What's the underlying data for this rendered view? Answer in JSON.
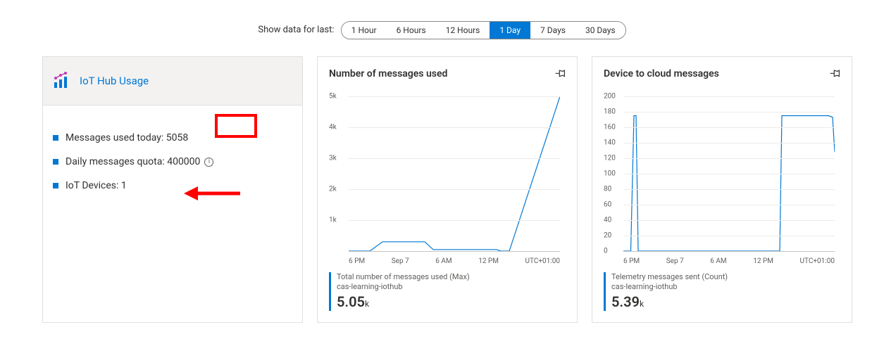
{
  "time_range": {
    "label": "Show data for last:",
    "options": [
      "1 Hour",
      "6 Hours",
      "12 Hours",
      "1 Day",
      "7 Days",
      "30 Days"
    ],
    "active_index": 3
  },
  "usage_card": {
    "title": "IoT Hub Usage",
    "rows": {
      "messages_used_label": "Messages used today:",
      "messages_used_value": "5058",
      "daily_quota_label": "Daily messages quota:",
      "daily_quota_value": "400000",
      "devices_label": "IoT Devices:",
      "devices_value": "1"
    }
  },
  "chart1": {
    "title": "Number of messages used",
    "metric_label": "Total number of messages used (Max)",
    "resource": "cas-learning-iothub",
    "value": "5.05",
    "unit": "k",
    "tz": "UTC+01:00"
  },
  "chart2": {
    "title": "Device to cloud messages",
    "metric_label": "Telemetry messages sent (Count)",
    "resource": "cas-learning-iothub",
    "value": "5.39",
    "unit": "k",
    "tz": "UTC+01:00"
  },
  "chart_data": [
    {
      "type": "line",
      "title": "Number of messages used",
      "xlabel": "",
      "ylabel": "",
      "ylim": [
        0,
        5000
      ],
      "x_ticks": [
        "6 PM",
        "Sep 7",
        "6 AM",
        "12 PM"
      ],
      "y_ticks": [
        1000,
        2000,
        3000,
        4000,
        5000
      ],
      "series": [
        {
          "name": "Total number of messages used (Max)",
          "x": [
            0.0,
            0.1,
            0.16,
            0.2,
            0.36,
            0.4,
            0.7,
            0.72,
            0.76,
            1.0
          ],
          "y": [
            0,
            0,
            300,
            300,
            300,
            50,
            50,
            0,
            0,
            5000
          ]
        }
      ]
    },
    {
      "type": "line",
      "title": "Device to cloud messages",
      "xlabel": "",
      "ylabel": "",
      "ylim": [
        0,
        200
      ],
      "x_ticks": [
        "6 PM",
        "Sep 7",
        "6 AM",
        "12 PM"
      ],
      "y_ticks": [
        0,
        20,
        40,
        60,
        80,
        100,
        120,
        140,
        160,
        180,
        200
      ],
      "series": [
        {
          "name": "Telemetry messages sent (Count)",
          "x": [
            0.0,
            0.035,
            0.05,
            0.06,
            0.07,
            0.74,
            0.75,
            0.97,
            0.99,
            1.0
          ],
          "y": [
            0,
            0,
            175,
            175,
            0,
            0,
            175,
            175,
            173,
            128
          ]
        }
      ]
    }
  ]
}
